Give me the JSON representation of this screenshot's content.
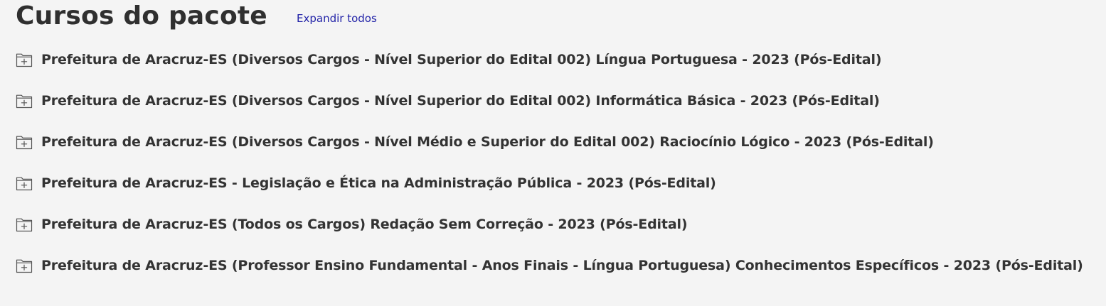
{
  "header": {
    "title": "Cursos do pacote",
    "expand_all_label": "Expandir todos",
    "expand_all_color": "#2324a8"
  },
  "courses": [
    {
      "title": "Prefeitura de Aracruz-ES (Diversos Cargos - Nível Superior do Edital 002) Língua Portuguesa - 2023 (Pós-Edital)",
      "icon": "folder-plus-icon"
    },
    {
      "title": "Prefeitura de Aracruz-ES (Diversos Cargos - Nível Superior do Edital 002) Informática Básica - 2023 (Pós-Edital)",
      "icon": "folder-plus-icon"
    },
    {
      "title": "Prefeitura de Aracruz-ES (Diversos Cargos - Nível Médio e Superior do Edital 002) Raciocínio Lógico - 2023 (Pós-Edital)",
      "icon": "folder-plus-icon"
    },
    {
      "title": "Prefeitura de Aracruz-ES - Legislação e Ética na Administração Pública - 2023 (Pós-Edital)",
      "icon": "folder-plus-icon"
    },
    {
      "title": "Prefeitura de Aracruz-ES (Todos os Cargos) Redação Sem Correção - 2023 (Pós-Edital)",
      "icon": "folder-plus-icon"
    },
    {
      "title": "Prefeitura de Aracruz-ES (Professor Ensino Fundamental - Anos Finais - Língua Portuguesa) Conhecimentos Específicos - 2023 (Pós-Edital)",
      "icon": "folder-plus-icon"
    }
  ],
  "colors": {
    "background": "#f4f4f4",
    "text": "#333333",
    "icon_stroke": "#555555"
  }
}
